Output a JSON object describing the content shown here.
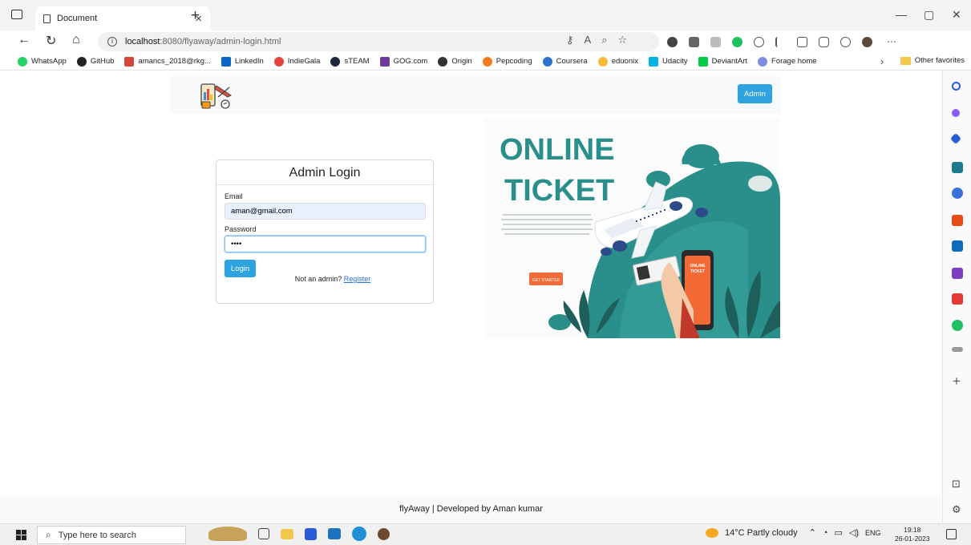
{
  "browser": {
    "tab_title": "Document",
    "tab_close": "×",
    "new_tab": "+",
    "window_controls": [
      "—",
      "▢",
      "✕"
    ],
    "url_host": "localhost",
    "url_path": ":8080/flyaway/admin-login.html",
    "bookmarks": [
      {
        "label": "WhatsApp",
        "color": "#25d366"
      },
      {
        "label": "GitHub",
        "color": "#222222"
      },
      {
        "label": "amancs_2018@rkg...",
        "color": "#d44638"
      },
      {
        "label": "LinkedIn",
        "color": "#0a66c2"
      },
      {
        "label": "IndieGala",
        "color": "#e2463b"
      },
      {
        "label": "sTEAM",
        "color": "#1b2838"
      },
      {
        "label": "GOG.com",
        "color": "#6c3a9a"
      },
      {
        "label": "Origin",
        "color": "#333333"
      },
      {
        "label": "Pepcoding",
        "color": "#f47c20"
      },
      {
        "label": "Coursera",
        "color": "#2a73cc"
      },
      {
        "label": "eduonix",
        "color": "#f5b93b"
      },
      {
        "label": "Udacity",
        "color": "#02b3e4"
      },
      {
        "label": "DeviantArt",
        "color": "#05cc47"
      },
      {
        "label": "Forage home",
        "color": "#7f8de1"
      }
    ],
    "bookmarks_more": "›",
    "other_favorites": "Other favorites"
  },
  "nav": {
    "admin_label": "Admin"
  },
  "login": {
    "title": "Admin Login",
    "email_label": "Email",
    "email_value": "aman@gmail.com",
    "password_label": "Password",
    "password_value": "aman",
    "button_label": "Login",
    "not_admin_text": "Not an admin?",
    "register_link": "Register"
  },
  "hero": {
    "line1": "ONLINE",
    "line2": "TICKET",
    "cta": "GET STARTED",
    "phone_text1": "ONLINE",
    "phone_text2": "TICKET"
  },
  "footer": {
    "text": "flyAway | Developed by Aman kumar"
  },
  "taskbar": {
    "search_placeholder": "Type here to search",
    "weather": "14°C  Partly cloudy",
    "lang": "ENG",
    "time": "19:18",
    "date": "26-01-2023"
  },
  "colors": {
    "primary_button": "#2ea3df",
    "hero_teal": "#2a8f8a",
    "hero_orange": "#f26a35"
  }
}
